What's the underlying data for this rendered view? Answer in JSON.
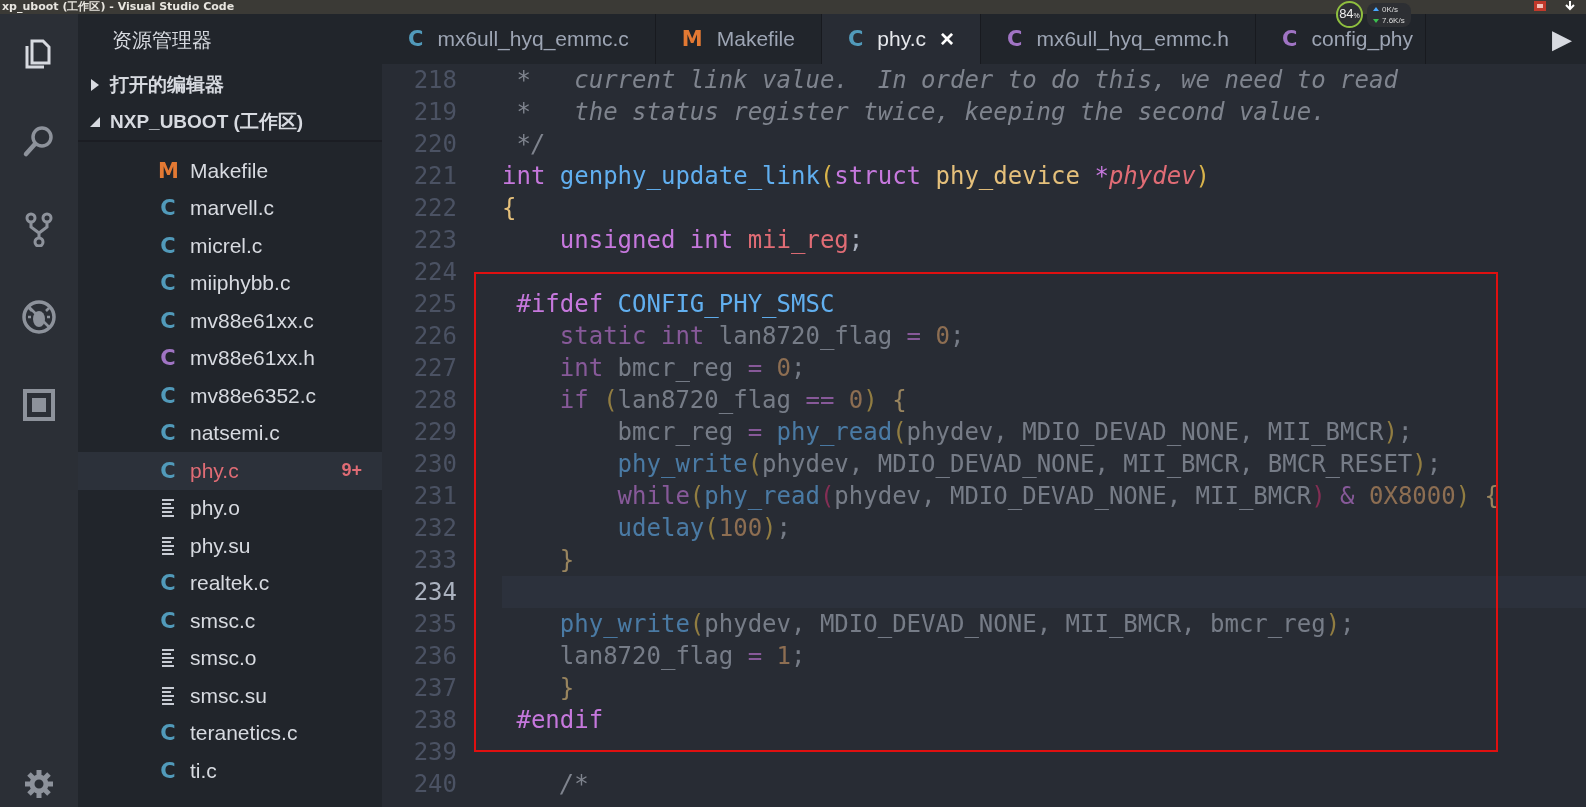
{
  "window": {
    "title": "xp_uboot (工作区) - Visual Studio Code"
  },
  "system_tray": {
    "cpu_percent": "84",
    "cpu_unit": "%",
    "upload": "0K/s",
    "download": "7.6K/s"
  },
  "activity_bar": [
    {
      "kind": "files",
      "selected": true
    },
    {
      "kind": "search",
      "selected": false
    },
    {
      "kind": "source-control",
      "selected": false
    },
    {
      "kind": "debug",
      "selected": false
    },
    {
      "kind": "extensions",
      "selected": false
    },
    {
      "kind": "settings",
      "selected": false
    }
  ],
  "sidebar": {
    "title": "资源管理器",
    "sections": [
      {
        "label": "打开的编辑器",
        "expanded": false
      },
      {
        "label": "NXP_UBOOT (工作区)",
        "expanded": true
      }
    ],
    "files": [
      {
        "name": "Makefile",
        "kind": "make",
        "icon": "M",
        "selected": false,
        "has_errors": false
      },
      {
        "name": "marvell.c",
        "kind": "c",
        "icon": "C",
        "selected": false,
        "has_errors": false
      },
      {
        "name": "micrel.c",
        "kind": "c",
        "icon": "C",
        "selected": false,
        "has_errors": false
      },
      {
        "name": "miiphybb.c",
        "kind": "c",
        "icon": "C",
        "selected": false,
        "has_errors": false
      },
      {
        "name": "mv88e61xx.c",
        "kind": "c",
        "icon": "C",
        "selected": false,
        "has_errors": false
      },
      {
        "name": "mv88e61xx.h",
        "kind": "h",
        "icon": "C",
        "selected": false,
        "has_errors": false
      },
      {
        "name": "mv88e6352.c",
        "kind": "c",
        "icon": "C",
        "selected": false,
        "has_errors": false
      },
      {
        "name": "natsemi.c",
        "kind": "c",
        "icon": "C",
        "selected": false,
        "has_errors": false
      },
      {
        "name": "phy.c",
        "kind": "c",
        "icon": "C",
        "selected": true,
        "has_errors": true,
        "badge": "9+"
      },
      {
        "name": "phy.o",
        "kind": "text",
        "selected": false,
        "has_errors": false
      },
      {
        "name": "phy.su",
        "kind": "text",
        "selected": false,
        "has_errors": false
      },
      {
        "name": "realtek.c",
        "kind": "c",
        "icon": "C",
        "selected": false,
        "has_errors": false
      },
      {
        "name": "smsc.c",
        "kind": "c",
        "icon": "C",
        "selected": false,
        "has_errors": false
      },
      {
        "name": "smsc.o",
        "kind": "text",
        "selected": false,
        "has_errors": false
      },
      {
        "name": "smsc.su",
        "kind": "text",
        "selected": false,
        "has_errors": false
      },
      {
        "name": "teranetics.c",
        "kind": "c",
        "icon": "C",
        "selected": false,
        "has_errors": false
      },
      {
        "name": "ti.c",
        "kind": "c",
        "icon": "C",
        "selected": false,
        "has_errors": false
      }
    ]
  },
  "tabs": [
    {
      "label": "mx6ull_hyq_emmc.c",
      "kind": "c",
      "icon": "C",
      "selected": false
    },
    {
      "label": "Makefile",
      "kind": "make",
      "icon": "M",
      "selected": false
    },
    {
      "label": "phy.c",
      "kind": "c",
      "icon": "C",
      "selected": true,
      "close": "×"
    },
    {
      "label": "mx6ull_hyq_emmc.h",
      "kind": "h",
      "icon": "C",
      "selected": false
    },
    {
      "label": "config_phy",
      "kind": "h",
      "icon": "C",
      "selected": false
    }
  ],
  "tabs_overflow": "▶",
  "editor": {
    "lines": [
      {
        "number": "218",
        "current": false,
        "inactive": false,
        "tokens": [
          {
            "kind": "comment",
            "text": " *   current link value.  In order to do this, we need to read"
          }
        ]
      },
      {
        "number": "219",
        "current": false,
        "inactive": false,
        "tokens": [
          {
            "kind": "comment",
            "text": " *   the status register twice, keeping the second value."
          }
        ]
      },
      {
        "number": "220",
        "current": false,
        "inactive": false,
        "tokens": [
          {
            "kind": "comment",
            "text": " */"
          }
        ]
      },
      {
        "number": "221",
        "current": false,
        "inactive": false,
        "tokens": [
          {
            "kind": "kw",
            "text": "int "
          },
          {
            "kind": "fn",
            "text": "genphy_update_link"
          },
          {
            "kind": "bracket",
            "text": "("
          },
          {
            "kind": "kw",
            "text": "struct "
          },
          {
            "kind": "type",
            "text": "phy_device "
          },
          {
            "kind": "op",
            "text": "*"
          },
          {
            "kind": "param",
            "text": "phydev"
          },
          {
            "kind": "bracket",
            "text": ")"
          }
        ]
      },
      {
        "number": "222",
        "current": false,
        "inactive": false,
        "tokens": [
          {
            "kind": "brace",
            "text": "{"
          }
        ]
      },
      {
        "number": "223",
        "current": false,
        "inactive": false,
        "tokens": [
          {
            "kind": "kw",
            "text": "    unsigned int "
          },
          {
            "kind": "var",
            "text": "mii_reg"
          },
          {
            "kind": "plain",
            "text": ";"
          }
        ]
      },
      {
        "number": "224",
        "current": false
      },
      {
        "number": "225",
        "current": false,
        "inactive": false,
        "tokens": [
          {
            "kind": "preproc",
            "text": " #ifdef "
          },
          {
            "kind": "macro",
            "text": "CONFIG_PHY_SMSC"
          }
        ]
      },
      {
        "number": "226",
        "current": false,
        "inactive": true,
        "tokens": [
          {
            "kind": "kw",
            "text": "    static int "
          },
          {
            "kind": "plain",
            "text": "lan8720_flag "
          },
          {
            "kind": "op",
            "text": "= "
          },
          {
            "kind": "num",
            "text": "0"
          },
          {
            "kind": "plain",
            "text": ";"
          }
        ]
      },
      {
        "number": "227",
        "current": false,
        "inactive": true,
        "tokens": [
          {
            "kind": "kw",
            "text": "    int "
          },
          {
            "kind": "plain",
            "text": "bmcr_reg "
          },
          {
            "kind": "op",
            "text": "= "
          },
          {
            "kind": "num",
            "text": "0"
          },
          {
            "kind": "plain",
            "text": ";"
          }
        ]
      },
      {
        "number": "228",
        "current": false,
        "inactive": true,
        "tokens": [
          {
            "kind": "kw",
            "text": "    if "
          },
          {
            "kind": "bracket",
            "text": "("
          },
          {
            "kind": "plain",
            "text": "lan8720_flag "
          },
          {
            "kind": "op",
            "text": "== "
          },
          {
            "kind": "num",
            "text": "0"
          },
          {
            "kind": "bracket",
            "text": ") "
          },
          {
            "kind": "brace",
            "text": "{"
          }
        ]
      },
      {
        "number": "229",
        "current": false,
        "inactive": true,
        "tokens": [
          {
            "kind": "plain",
            "text": "        bmcr_reg "
          },
          {
            "kind": "op",
            "text": "= "
          },
          {
            "kind": "fn",
            "text": "phy_read"
          },
          {
            "kind": "bracket",
            "text": "("
          },
          {
            "kind": "plain",
            "text": "phydev, MDIO_DEVAD_NONE, MII_BMCR"
          },
          {
            "kind": "bracket",
            "text": ")"
          },
          {
            "kind": "plain",
            "text": ";"
          }
        ]
      },
      {
        "number": "230",
        "current": false,
        "inactive": true,
        "tokens": [
          {
            "kind": "fn",
            "text": "        phy_write"
          },
          {
            "kind": "bracket",
            "text": "("
          },
          {
            "kind": "plain",
            "text": "phydev, MDIO_DEVAD_NONE, MII_BMCR, BMCR_RESET"
          },
          {
            "kind": "bracket",
            "text": ")"
          },
          {
            "kind": "plain",
            "text": ";"
          }
        ]
      },
      {
        "number": "231",
        "current": false,
        "inactive": true,
        "tokens": [
          {
            "kind": "kw",
            "text": "        while"
          },
          {
            "kind": "bracket",
            "text": "("
          },
          {
            "kind": "fn",
            "text": "phy_read"
          },
          {
            "kind": "bracket2",
            "text": "("
          },
          {
            "kind": "plain",
            "text": "phydev, MDIO_DEVAD_NONE, MII_BMCR"
          },
          {
            "kind": "bracket2",
            "text": ") "
          },
          {
            "kind": "op",
            "text": "& "
          },
          {
            "kind": "num",
            "text": "0X8000"
          },
          {
            "kind": "bracket",
            "text": ") "
          },
          {
            "kind": "brace",
            "text": "{"
          }
        ]
      },
      {
        "number": "232",
        "current": false,
        "inactive": true,
        "tokens": [
          {
            "kind": "fn",
            "text": "        udelay"
          },
          {
            "kind": "bracket",
            "text": "("
          },
          {
            "kind": "num",
            "text": "100"
          },
          {
            "kind": "bracket",
            "text": ")"
          },
          {
            "kind": "plain",
            "text": ";"
          }
        ]
      },
      {
        "number": "233",
        "current": false,
        "inactive": true,
        "tokens": [
          {
            "kind": "brace",
            "text": "    }"
          }
        ]
      },
      {
        "number": "234",
        "current": true
      },
      {
        "number": "235",
        "current": false,
        "inactive": true,
        "tokens": [
          {
            "kind": "fn",
            "text": "    phy_write"
          },
          {
            "kind": "bracket",
            "text": "("
          },
          {
            "kind": "plain",
            "text": "phydev, MDIO_DEVAD_NONE, MII_BMCR, bmcr_reg"
          },
          {
            "kind": "bracket",
            "text": ")"
          },
          {
            "kind": "plain",
            "text": ";"
          }
        ]
      },
      {
        "number": "236",
        "current": false,
        "inactive": true,
        "tokens": [
          {
            "kind": "plain",
            "text": "    lan8720_flag "
          },
          {
            "kind": "op",
            "text": "= "
          },
          {
            "kind": "num",
            "text": "1"
          },
          {
            "kind": "plain",
            "text": ";"
          }
        ]
      },
      {
        "number": "237",
        "current": false,
        "inactive": true,
        "tokens": [
          {
            "kind": "brace",
            "text": "    }"
          }
        ]
      },
      {
        "number": "238",
        "current": false,
        "inactive": false,
        "tokens": [
          {
            "kind": "preproc",
            "text": " #endif"
          }
        ]
      },
      {
        "number": "239",
        "current": false
      },
      {
        "number": "240",
        "current": false,
        "inactive": false,
        "tokens": [
          {
            "kind": "comment",
            "text": "    /*"
          }
        ]
      }
    ]
  }
}
